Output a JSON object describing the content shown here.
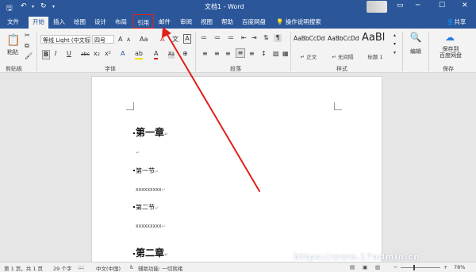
{
  "titlebar": {
    "title": "文档1 - Word",
    "save_glyph": "🖫",
    "undo_glyph": "↶",
    "redo_glyph": "↻",
    "qa_more_glyph": "▾",
    "ribbon_opts_glyph": "▭",
    "min_glyph": "─",
    "max_glyph": "☐",
    "close_glyph": "✕"
  },
  "tabs": [
    {
      "label": "文件"
    },
    {
      "label": "开始"
    },
    {
      "label": "插入"
    },
    {
      "label": "绘图"
    },
    {
      "label": "设计"
    },
    {
      "label": "布局"
    },
    {
      "label": "引用"
    },
    {
      "label": "邮件"
    },
    {
      "label": "审阅"
    },
    {
      "label": "视图"
    },
    {
      "label": "帮助"
    },
    {
      "label": "百度网盘"
    }
  ],
  "tell_me": "操作说明搜索",
  "share": "共享",
  "ribbon": {
    "paste_label": "粘贴",
    "font_name": "等线 Light (中文标",
    "font_size": "四号",
    "font_glyphs": [
      "A",
      "A",
      "Aa",
      "A",
      "文",
      "A"
    ],
    "format_glyphs": [
      "B",
      "I",
      "U",
      "abc",
      "x₂",
      "x²",
      "A",
      "ab",
      "A",
      "Aa",
      "A",
      "⊕"
    ],
    "para_glyphs": [
      "≔",
      "≔",
      "≔",
      "⇤",
      "⇥",
      "⇅",
      "¶",
      "≡",
      "≡",
      "≡",
      "≡",
      "≡",
      "↕",
      "▧",
      "▦"
    ],
    "styles": [
      {
        "preview": "AaBbCcDd",
        "name": "↵ 正文"
      },
      {
        "preview": "AaBbCcDd",
        "name": "↵ 无间隔"
      },
      {
        "preview": "AaBl",
        "name": "标题 1"
      }
    ],
    "edit_label": "编辑",
    "baidu_label": "保存到\n百度网盘",
    "groups": [
      "剪贴板",
      "字体",
      "段落",
      "样式",
      "保存"
    ]
  },
  "document": {
    "lines": [
      {
        "text": "第一章",
        "style": "h1"
      },
      {
        "text": "",
        "style": "para"
      },
      {
        "text": "第一节",
        "style": "h2"
      },
      {
        "text": "XXXXXXXXX",
        "style": "body"
      },
      {
        "text": "第二节",
        "style": "h2"
      },
      {
        "text": "XXXXXXXXX",
        "style": "body"
      },
      {
        "text": "第二章",
        "style": "h1"
      }
    ],
    "para_mark": "↵"
  },
  "status": {
    "page": "第 1 页，共 1 页",
    "words": "29 个字",
    "language": "中文(中国)",
    "a11y": "辅助功能: 一切就绪",
    "zoom_minus": "−",
    "zoom_plus": "+",
    "zoom": "78%"
  },
  "watermark": "https://www.17admin.cn",
  "colors": {
    "brand": "#2b579a",
    "highlight": "#e0201a",
    "arrow": "#e0201a"
  }
}
